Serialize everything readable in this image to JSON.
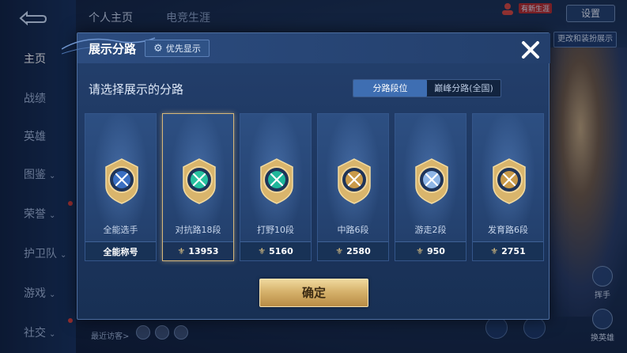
{
  "background": {
    "top_tabs": [
      "个人主页",
      "电竞生涯"
    ],
    "settings_label": "设置",
    "user_tag": "有新生涯",
    "side_button_label": "更改和装扮展示",
    "sidebar": [
      {
        "label": "主页",
        "active": true,
        "chevron": false
      },
      {
        "label": "战绩",
        "active": false,
        "chevron": false
      },
      {
        "label": "英雄",
        "active": false,
        "chevron": false
      },
      {
        "label": "图鉴",
        "active": false,
        "chevron": true
      },
      {
        "label": "荣誉",
        "active": false,
        "chevron": true
      },
      {
        "label": "护卫队",
        "active": false,
        "chevron": true
      },
      {
        "label": "游戏",
        "active": false,
        "chevron": true
      },
      {
        "label": "社交",
        "active": false,
        "chevron": true
      }
    ],
    "visitor_label": "最近访客>",
    "right_icons": [
      "挥手",
      "换英雄"
    ]
  },
  "modal": {
    "title": "展示分路",
    "priority_label": "优先显示",
    "subtitle": "请选择展示的分路",
    "segments": [
      {
        "label": "分路段位",
        "active": true
      },
      {
        "label": "巅峰分路(全国)",
        "active": false
      }
    ],
    "cards": [
      {
        "label": "全能选手",
        "footer": "全能称号",
        "show_rank_icon": false,
        "selected": false,
        "icon": "all-round-badge-icon",
        "color": "#3a6fc2"
      },
      {
        "label": "对抗路18段",
        "footer": "13953",
        "show_rank_icon": true,
        "selected": true,
        "icon": "clash-lane-badge-icon",
        "color": "#28c2a0"
      },
      {
        "label": "打野10段",
        "footer": "5160",
        "show_rank_icon": true,
        "selected": false,
        "icon": "jungle-badge-icon",
        "color": "#1fb69a"
      },
      {
        "label": "中路6段",
        "footer": "2580",
        "show_rank_icon": true,
        "selected": false,
        "icon": "mid-lane-badge-icon",
        "color": "#c99a4a"
      },
      {
        "label": "游走2段",
        "footer": "950",
        "show_rank_icon": true,
        "selected": false,
        "icon": "roam-badge-icon",
        "color": "#8fb6e6"
      },
      {
        "label": "发育路6段",
        "footer": "2751",
        "show_rank_icon": true,
        "selected": false,
        "icon": "farm-lane-badge-icon",
        "color": "#c99a4a"
      }
    ],
    "confirm_label": "确定"
  }
}
